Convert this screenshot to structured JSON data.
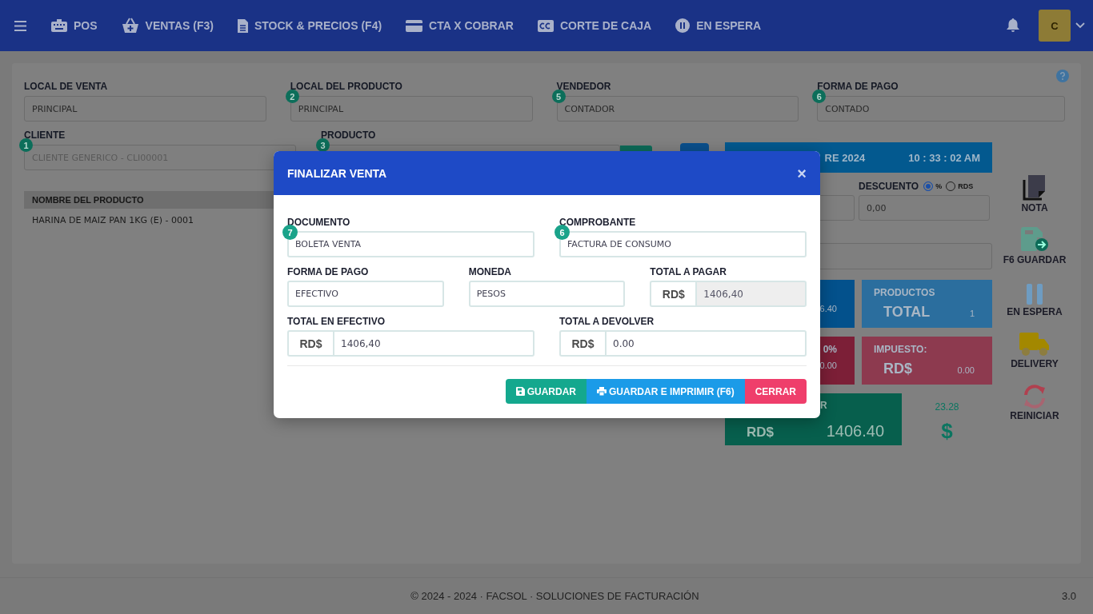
{
  "nav": {
    "items": [
      {
        "label": "POS"
      },
      {
        "label": "VENTAS (F3)"
      },
      {
        "label": "STOCK & PRECIOS (F4)"
      },
      {
        "label": "CTA X COBRAR"
      },
      {
        "label": "CORTE DE CAJA"
      },
      {
        "label": "EN ESPERA"
      }
    ],
    "user": {
      "initial": "C"
    }
  },
  "header_fields": [
    {
      "label": "LOCAL DE VENTA",
      "value": "PRINCIPAL"
    },
    {
      "label": "LOCAL DEL PRODUCTO",
      "badge": "2",
      "value": "PRINCIPAL"
    },
    {
      "label": "VENDEDOR",
      "badge": "5",
      "value": "CONTADOR"
    },
    {
      "label": "FORMA DE PAGO",
      "badge": "6",
      "value": "CONTADO"
    }
  ],
  "cliente": {
    "label": "CLIENTE",
    "badge": "1",
    "placeholder": "CLIENTE GENERICO - CLI00001"
  },
  "producto": {
    "label": "PRODUCTO",
    "badge": "3"
  },
  "table": {
    "columns": [
      "NOMBRE DEL PRODUCTO"
    ],
    "rows": [
      [
        "HARINA DE MAIZ PAN 1KG (E) - 0001"
      ]
    ]
  },
  "date_bar": {
    "date": "RE 2024",
    "time": "10 : 33 : 02 AM"
  },
  "descuento": {
    "label": "DESCUENTO",
    "options": [
      {
        "label": "%",
        "selected": true
      },
      {
        "label": "RDS",
        "selected": false
      }
    ],
    "value": "0,00"
  },
  "tile_rows": [
    [
      {
        "kind": "cut",
        "color": "#03518c",
        "value": "6.40"
      },
      {
        "kind": "full",
        "color": "#2b6e9e",
        "title": "PRODUCTOS",
        "label": "TOTAL",
        "value": "1"
      }
    ],
    [
      {
        "kind": "cut",
        "color": "#7c1f37",
        "title": "0%",
        "value": "0.00"
      },
      {
        "kind": "full",
        "color": "#8d3a4f",
        "title": "IMPUESTO:",
        "label": "RD$",
        "value": "0.00"
      }
    ]
  ],
  "total": {
    "title": "R",
    "label": "RD$",
    "value": "1406.40"
  },
  "exchange": {
    "rate": "23.28",
    "symbol": "$"
  },
  "actions": [
    {
      "label": "NOTA"
    },
    {
      "label": "F6 GUARDAR"
    },
    {
      "label": "EN ESPERA"
    },
    {
      "label": "DELIVERY"
    },
    {
      "label": "REINICIAR"
    }
  ],
  "modal": {
    "title": "FINALIZAR VENTA",
    "close": "×",
    "rows": [
      [
        {
          "label": "DOCUMENTO",
          "badge": "7",
          "value": "BOLETA VENTA",
          "disabled": false
        },
        {
          "label": "COMPROBANTE",
          "badge": "6",
          "value": "FACTURA DE CONSUMO",
          "disabled": false
        }
      ],
      [
        {
          "label": "FORMA DE PAGO",
          "value": "EFECTIVO",
          "disabled": false
        },
        {
          "label": "MONEDA",
          "value": "PESOS",
          "disabled": false
        },
        {
          "label": "TOTAL A PAGAR",
          "prefix": "RD$",
          "value": "1406,40",
          "disabled": true
        }
      ],
      [
        {
          "label": "TOTAL EN EFECTIVO",
          "prefix": "RD$",
          "value": "1406,40",
          "disabled": false
        },
        {
          "label": "TOTAL A DEVOLVER",
          "prefix": "RD$",
          "value": "0.00",
          "disabled": false
        }
      ]
    ],
    "buttons": [
      {
        "kind": "save",
        "label": "GUARDAR"
      },
      {
        "kind": "print",
        "label": "GUARDAR E IMPRIMIR (F6)"
      },
      {
        "kind": "close",
        "label": "CERRAR"
      }
    ]
  },
  "footer": {
    "text": "© 2024 - 2024 · FACSOL · SOLUCIONES DE FACTURACIÓN",
    "version": "3.0"
  }
}
